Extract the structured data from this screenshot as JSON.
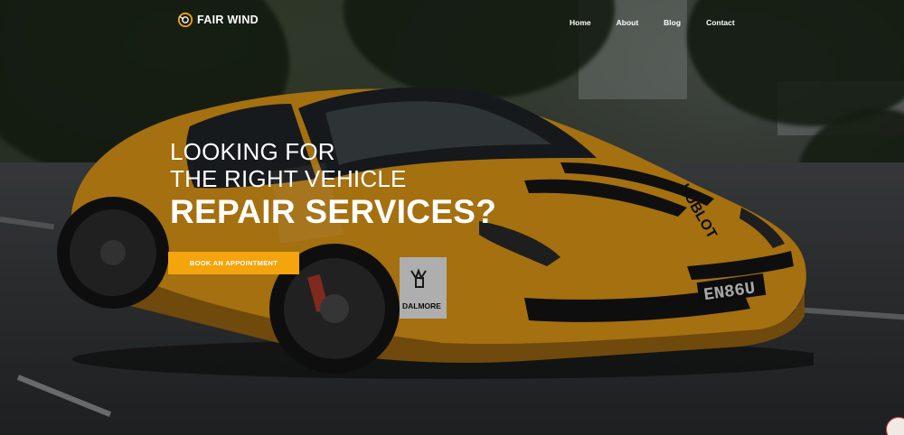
{
  "brand": {
    "name": "FAIR WIND",
    "accent_color": "#f4a40c",
    "logo_icon": "wheel-gauge-icon"
  },
  "nav": {
    "items": [
      {
        "label": "Home"
      },
      {
        "label": "About"
      },
      {
        "label": "Blog"
      },
      {
        "label": "Contact"
      }
    ]
  },
  "hero": {
    "line1": "LOOKING FOR",
    "line2": "THE RIGHT VEHICLE",
    "line3": "REPAIR SERVICES?",
    "cta_label": "BOOK AN APPOINTMENT"
  },
  "car": {
    "plate": "EN86U",
    "sticker": "DALMORE",
    "hood_text": "HUBLOT",
    "body_color": "#e8a019"
  }
}
